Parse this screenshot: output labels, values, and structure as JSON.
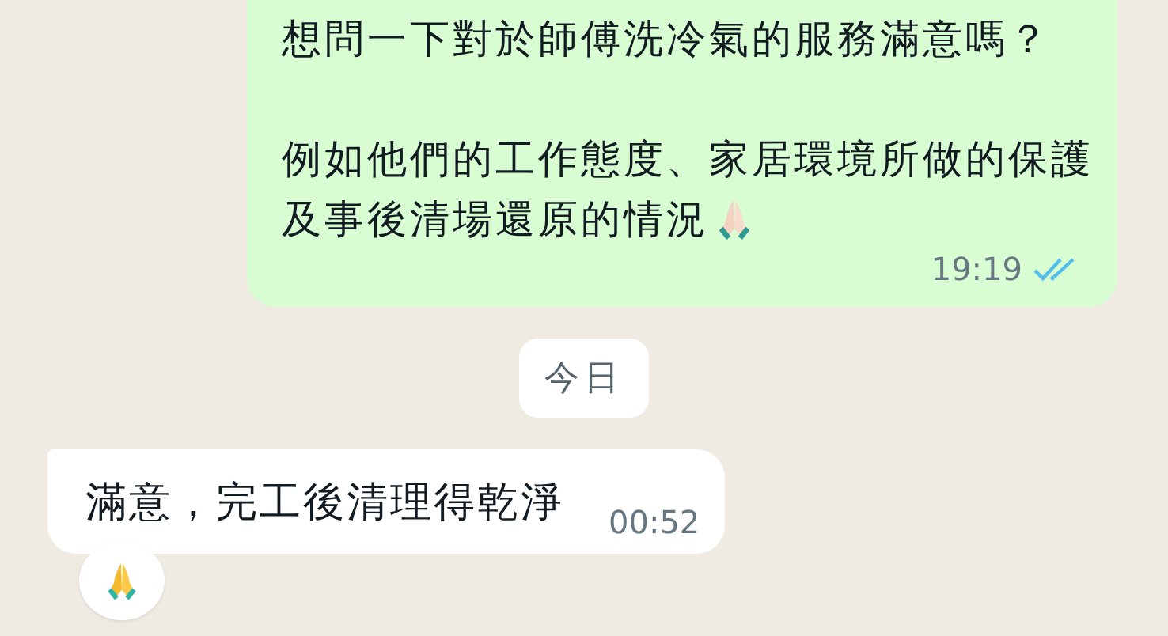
{
  "messages": [
    {
      "kind": "outgoing",
      "paragraphs": [
        "想問一下對於師傅洗冷氣的服務滿意嗎？",
        "例如他們的工作態度、家居環境所做的保護及事後清場還原的情況"
      ],
      "emoji_end": true,
      "time": "19:19",
      "read": true
    },
    {
      "kind": "date",
      "text": "今日"
    },
    {
      "kind": "incoming",
      "text": "滿意，完工後清理得乾淨",
      "time": "00:52",
      "reaction": true
    }
  ]
}
